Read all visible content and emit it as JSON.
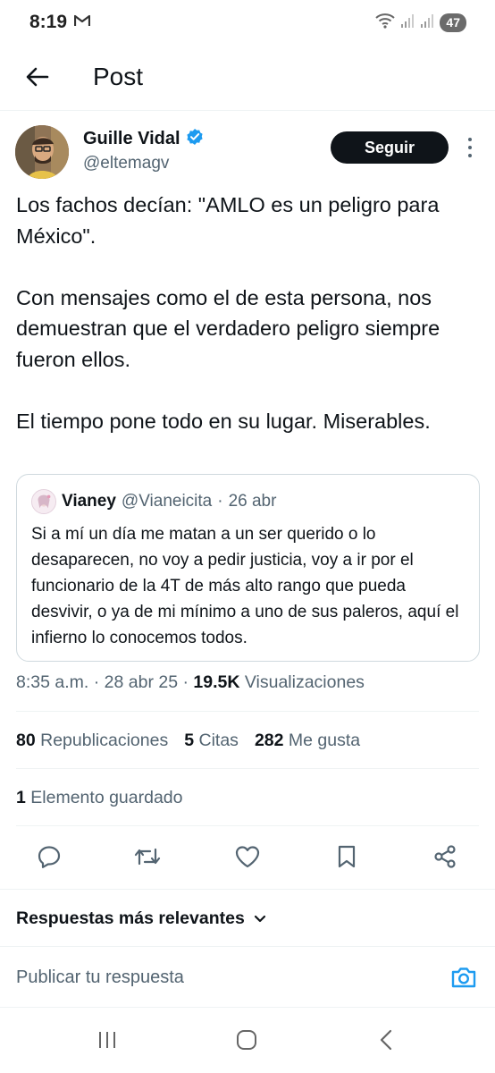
{
  "status_bar": {
    "time": "8:19",
    "mail_icon": "gmail-icon",
    "battery": "47"
  },
  "header": {
    "title": "Post",
    "back_icon": "arrow-left-icon"
  },
  "author": {
    "name": "Guille Vidal",
    "handle": "@eltemagv",
    "verified": true,
    "follow_label": "Seguir"
  },
  "post": {
    "text": "Los fachos decían: \"AMLO es un peligro para México\".\n\nCon mensajes como el de esta persona, nos demuestran que el verdadero peligro siempre fueron ellos.\n\nEl tiempo pone todo en su lugar. Miserables."
  },
  "quote": {
    "name": "Vianey",
    "handle": "@Vianeicita",
    "separator": "·",
    "date": "26 abr",
    "text": "Si a mí un día me matan a un ser querido o lo desaparecen, no voy a pedir justicia, voy a ir por el funcionario de la 4T de más alto rango que pueda desvivir, o ya de mi mínimo a uno de sus paleros, aquí el infierno lo conocemos todos."
  },
  "meta": {
    "time": "8:35 a.m.",
    "date": "28 abr 25",
    "separator": "·",
    "views_count": "19.5K",
    "views_label": "Visualizaciones"
  },
  "stats": {
    "reposts_count": "80",
    "reposts_label": "Republicaciones",
    "quotes_count": "5",
    "quotes_label": "Citas",
    "likes_count": "282",
    "likes_label": "Me gusta"
  },
  "saved": {
    "count": "1",
    "label": "Elemento guardado"
  },
  "actions": {
    "reply_icon": "reply-icon",
    "repost_icon": "repost-icon",
    "like_icon": "heart-icon",
    "bookmark_icon": "bookmark-icon",
    "share_icon": "share-icon"
  },
  "replies": {
    "sort_label": "Respuestas más relevantes",
    "composer_placeholder": "Publicar tu respuesta"
  },
  "colors": {
    "text": "#0f1419",
    "secondary": "#536471",
    "accent": "#1d9bf0",
    "border": "#cfd9de"
  }
}
